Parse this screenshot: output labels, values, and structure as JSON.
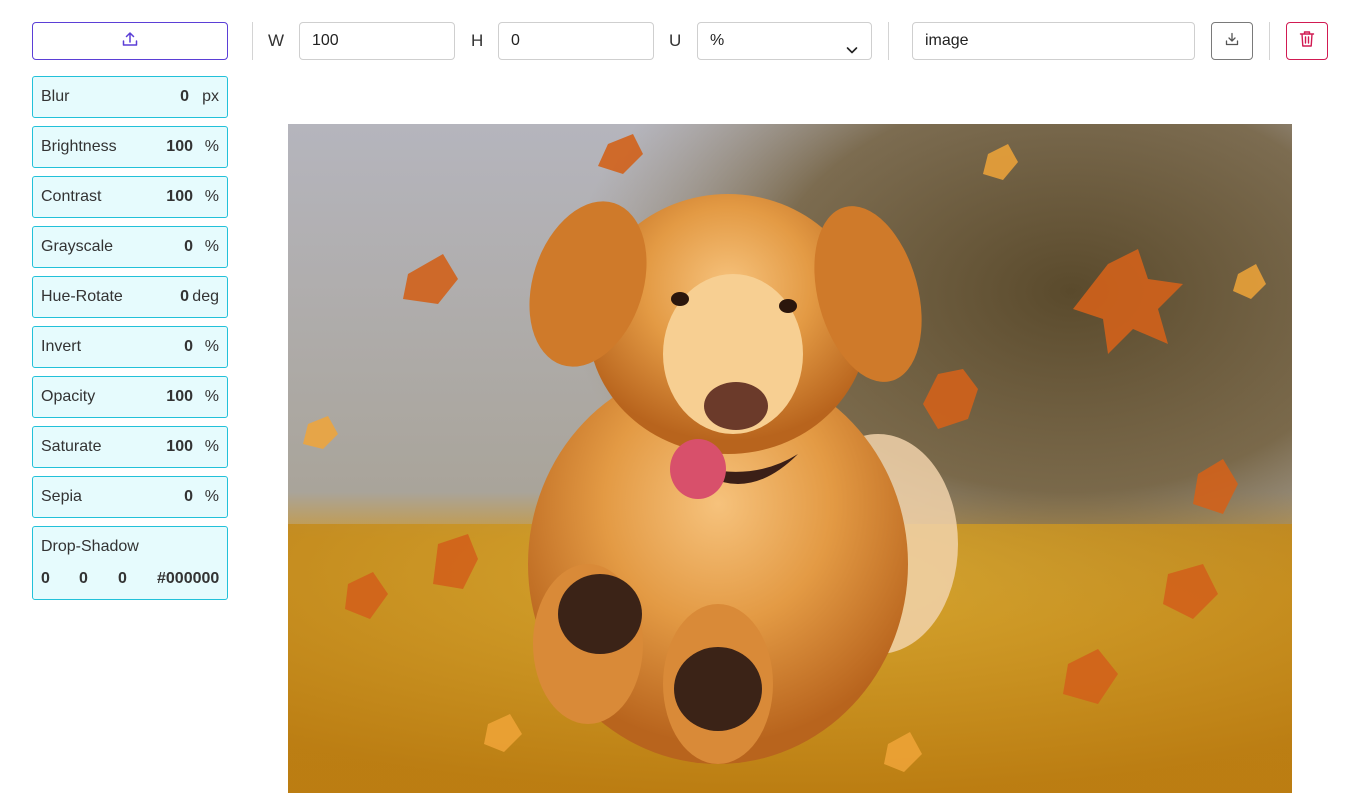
{
  "toolbar": {
    "upload_icon": "upload-icon",
    "width_label": "W",
    "width_value": "100",
    "height_label": "H",
    "height_value": "0",
    "unit_label": "U",
    "unit_value": "%",
    "filename_value": "image",
    "download_icon": "download-icon",
    "delete_icon": "trash-icon",
    "accent_upload": "#5b3fd6",
    "accent_delete": "#d11a52"
  },
  "filters": [
    {
      "name": "Blur",
      "value": "0",
      "unit": "px"
    },
    {
      "name": "Brightness",
      "value": "100",
      "unit": "%"
    },
    {
      "name": "Contrast",
      "value": "100",
      "unit": "%"
    },
    {
      "name": "Grayscale",
      "value": "0",
      "unit": "%"
    },
    {
      "name": "Hue-Rotate",
      "value": "0",
      "unit": "deg"
    },
    {
      "name": "Invert",
      "value": "0",
      "unit": "%"
    },
    {
      "name": "Opacity",
      "value": "100",
      "unit": "%"
    },
    {
      "name": "Saturate",
      "value": "100",
      "unit": "%"
    },
    {
      "name": "Sepia",
      "value": "0",
      "unit": "%"
    }
  ],
  "drop_shadow": {
    "name": "Drop-Shadow",
    "x": "0",
    "y": "0",
    "blur": "0",
    "color": "#000000"
  },
  "colors": {
    "filter_border": "#22c1d9",
    "filter_bg": "#e6fbfd"
  }
}
